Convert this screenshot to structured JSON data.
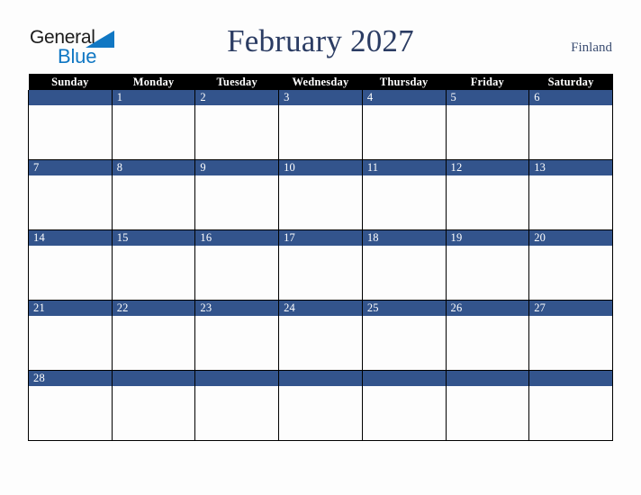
{
  "brand": {
    "name_part1": "General",
    "name_part2": "Blue",
    "triangle_icon": "blue-triangle-icon",
    "accent_color": "#1077c3"
  },
  "header": {
    "title": "February 2027",
    "country": "Finland",
    "title_color": "#2b3c63"
  },
  "calendar": {
    "month": "February",
    "year": "2027",
    "accent_color": "#33548c",
    "header_bg": "#000000",
    "weekdays": [
      "Sunday",
      "Monday",
      "Tuesday",
      "Wednesday",
      "Thursday",
      "Friday",
      "Saturday"
    ],
    "weeks": [
      [
        {
          "day": ""
        },
        {
          "day": "1"
        },
        {
          "day": "2"
        },
        {
          "day": "3"
        },
        {
          "day": "4"
        },
        {
          "day": "5"
        },
        {
          "day": "6"
        }
      ],
      [
        {
          "day": "7"
        },
        {
          "day": "8"
        },
        {
          "day": "9"
        },
        {
          "day": "10"
        },
        {
          "day": "11"
        },
        {
          "day": "12"
        },
        {
          "day": "13"
        }
      ],
      [
        {
          "day": "14"
        },
        {
          "day": "15"
        },
        {
          "day": "16"
        },
        {
          "day": "17"
        },
        {
          "day": "18"
        },
        {
          "day": "19"
        },
        {
          "day": "20"
        }
      ],
      [
        {
          "day": "21"
        },
        {
          "day": "22"
        },
        {
          "day": "23"
        },
        {
          "day": "24"
        },
        {
          "day": "25"
        },
        {
          "day": "26"
        },
        {
          "day": "27"
        }
      ],
      [
        {
          "day": "28"
        },
        {
          "day": ""
        },
        {
          "day": ""
        },
        {
          "day": ""
        },
        {
          "day": ""
        },
        {
          "day": ""
        },
        {
          "day": ""
        }
      ]
    ]
  }
}
